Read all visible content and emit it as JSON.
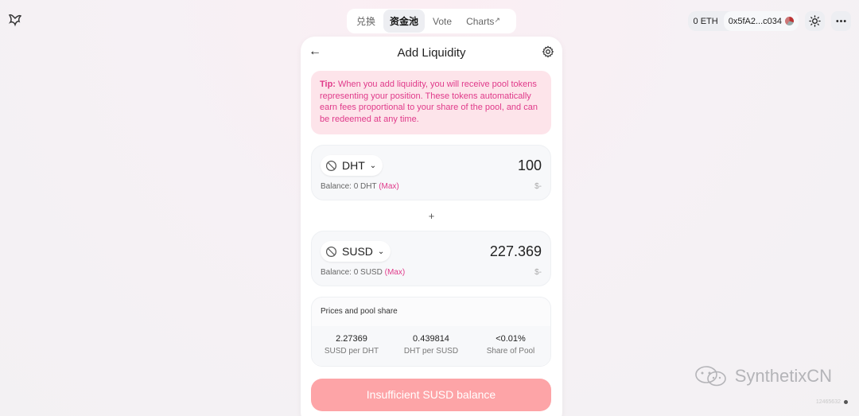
{
  "nav": {
    "items": [
      {
        "label": "兑换"
      },
      {
        "label": "资金池"
      },
      {
        "label": "Vote"
      },
      {
        "label": "Charts"
      }
    ],
    "charts_ext": "↗"
  },
  "wallet": {
    "eth_balance": "0 ETH",
    "address": "0x5fA2...c034"
  },
  "icons": {
    "theme": "sun-icon",
    "more": "more-icon"
  },
  "card": {
    "title": "Add Liquidity",
    "tip_label": "Tip:",
    "tip_text": " When you add liquidity, you will receive pool tokens representing your position. These tokens automatically earn fees proportional to your share of the pool, and can be redeemed at any time."
  },
  "token_a": {
    "symbol": "DHT",
    "amount": "100",
    "balance": "Balance: 0 DHT",
    "max": "(Max)",
    "usd": "$-"
  },
  "plus": "+",
  "token_b": {
    "symbol": "SUSD",
    "amount": "227.369",
    "balance": "Balance: 0 SUSD",
    "max": "(Max)",
    "usd": "$-"
  },
  "prices": {
    "heading": "Prices and pool share",
    "cols": [
      {
        "value": "2.27369",
        "label": "SUSD per DHT"
      },
      {
        "value": "0.439814",
        "label": "DHT per SUSD"
      },
      {
        "value": "<0.01%",
        "label": "Share of Pool"
      }
    ]
  },
  "submit_label": "Insufficient SUSD balance",
  "watermark": "SynthetixCN",
  "version": "12465632",
  "colors": {
    "accent": "#e03a8a",
    "tip_bg": "#fde4ea",
    "button": "#fda4a7"
  }
}
